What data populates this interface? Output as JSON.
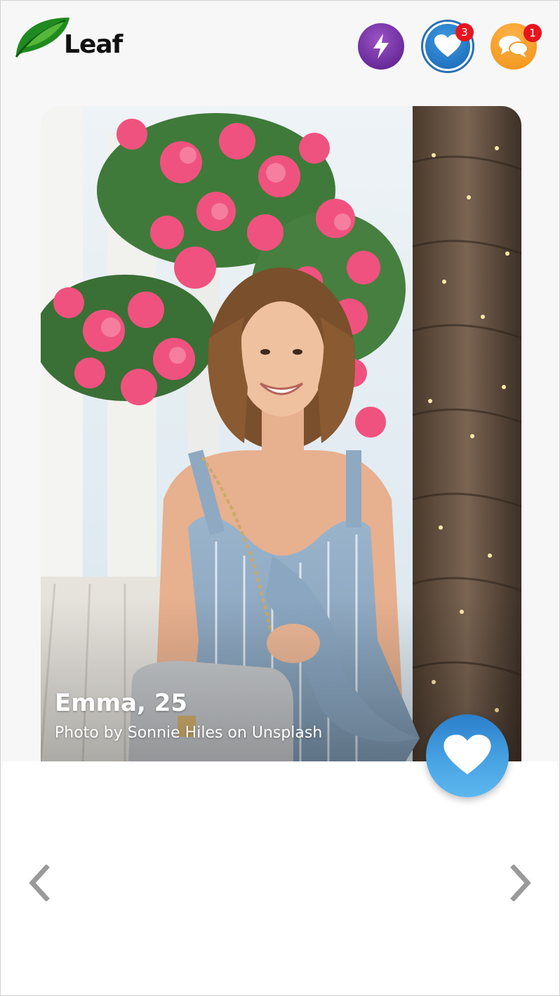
{
  "app": {
    "logo_text": "Leaf",
    "brand_color": "#1f7a1f"
  },
  "header": {
    "boost_icon": "lightning-icon",
    "likes_icon": "heart-icon",
    "likes_badge": "3",
    "chats_icon": "chat-bubbles-icon",
    "chats_badge": "1"
  },
  "profile": {
    "name_age": "Emma, 25",
    "photo_credit": "Photo by Sonnie Hiles on Unsplash"
  },
  "actions": {
    "like_icon": "heart-icon",
    "prev_icon": "chevron-left-icon",
    "next_icon": "chevron-right-icon"
  },
  "colors": {
    "like_button": "#3c94dc",
    "boost_button": "#7a3aaa",
    "chats_button": "#f5a02a",
    "badge": "#e8141e"
  }
}
